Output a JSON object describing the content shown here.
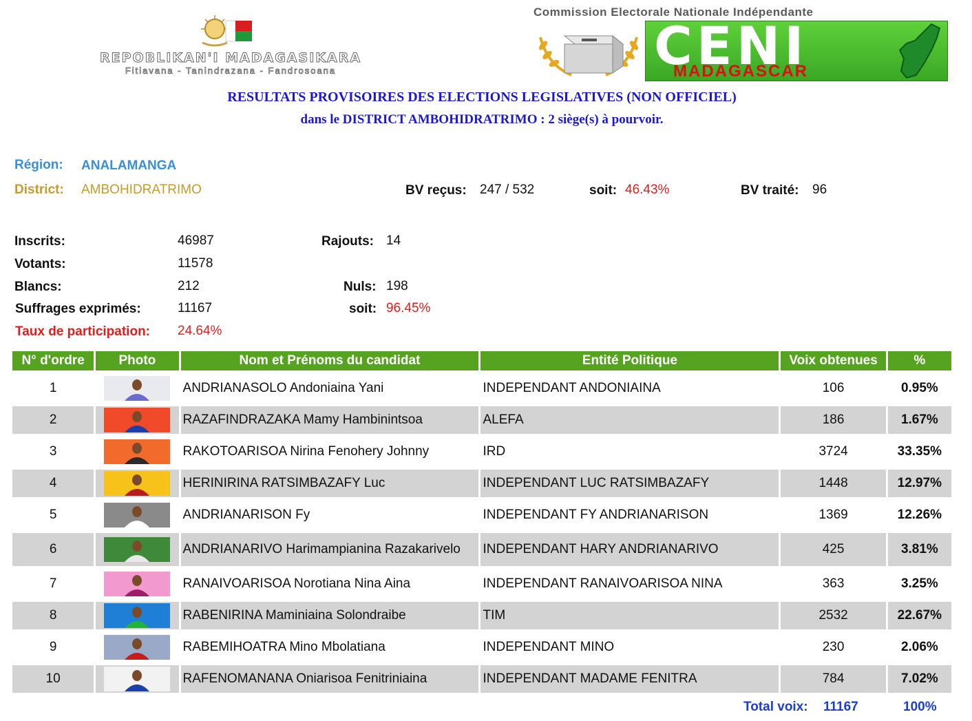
{
  "header": {
    "republic_name": "REPOBLIKAN'I MADAGASIKARA",
    "republic_motto": "Fitiavana - Tanindrazana - Fandrosoana",
    "commission_name": "Commission Electorale Nationale Indépendante",
    "ceni_acronym": "CENI",
    "ceni_country": "MADAGASCAR"
  },
  "title": {
    "line1": "RESULTATS PROVISOIRES DES ELECTIONS LEGISLATIVES (NON OFFICIEL)",
    "line2": "dans le DISTRICT  AMBOHIDRATRIMO : 2 siège(s) à pourvoir."
  },
  "info": {
    "region_label": "Région:",
    "region_value": "ANALAMANGA",
    "district_label": "District:",
    "district_value": "AMBOHIDRATRIMO",
    "bv_recus_label": "BV reçus:",
    "bv_recus_value": "247 / 532",
    "soit_label": "soit:",
    "soit_value": "46.43%",
    "bv_traite_label": "BV traité:",
    "bv_traite_value": "96"
  },
  "stats": {
    "inscrits_label": "Inscrits:",
    "inscrits_value": "46987",
    "rajouts_label": "Rajouts:",
    "rajouts_value": "14",
    "votants_label": "Votants:",
    "votants_value": "11578",
    "blancs_label": "Blancs:",
    "blancs_value": "212",
    "nuls_label": "Nuls:",
    "nuls_value": "198",
    "suffrages_label": "Suffrages exprimés:",
    "suffrages_value": "11167",
    "soit_label": "soit:",
    "soit_value": "96.45%",
    "taux_label": "Taux de participation:",
    "taux_value": "24.64%"
  },
  "table": {
    "headers": [
      "N° d'ordre",
      "Photo",
      "Nom et Prénoms du candidat",
      "Entité Politique",
      "Voix obtenues",
      "%"
    ],
    "rows": [
      {
        "num": "1",
        "name": "ANDRIANASOLO Andoniaina Yani",
        "entity": "INDEPENDANT ANDONIAINA",
        "votes": "106",
        "pct": "0.95%",
        "photo_bg": "#e9e9f0",
        "photo_accent": "#6a6ad0"
      },
      {
        "num": "2",
        "name": "RAZAFINDRAZAKA Mamy Hambinintsoa",
        "entity": "ALEFA",
        "votes": "186",
        "pct": "1.67%",
        "photo_bg": "#f04a2a",
        "photo_accent": "#1d3fa8"
      },
      {
        "num": "3",
        "name": "RAKOTOARISOA Nirina Fenohery Johnny",
        "entity": "IRD",
        "votes": "3724",
        "pct": "33.35%",
        "photo_bg": "#f26a2c",
        "photo_accent": "#2a2a2a"
      },
      {
        "num": "4",
        "name": "HERINIRINA RATSIMBAZAFY Luc",
        "entity": "INDEPENDANT LUC RATSIMBAZAFY",
        "votes": "1448",
        "pct": "12.97%",
        "photo_bg": "#f7c21a",
        "photo_accent": "#b81d1d"
      },
      {
        "num": "5",
        "name": "ANDRIANARISON Fy",
        "entity": "INDEPENDANT FY ANDRIANARISON",
        "votes": "1369",
        "pct": "12.26%",
        "photo_bg": "#8a8a8a",
        "photo_accent": "#ffffff"
      },
      {
        "num": "6",
        "name": "ANDRIANARIVO Harimampianina Razakarivelo",
        "entity": "INDEPENDANT HARY ANDRIANARIVO",
        "votes": "425",
        "pct": "3.81%",
        "photo_bg": "#3f8a3a",
        "photo_accent": "#e8e8e8"
      },
      {
        "num": "7",
        "name": "RANAIVOARISOA Norotiana Nina Aina",
        "entity": "INDEPENDANT RANAIVOARISOA NINA",
        "votes": "363",
        "pct": "3.25%",
        "photo_bg": "#f29ad0",
        "photo_accent": "#a01d6a"
      },
      {
        "num": "8",
        "name": "RABENIRINA Maminiaina Solondraibe",
        "entity": "TIM",
        "votes": "2532",
        "pct": "22.67%",
        "photo_bg": "#1f7fd6",
        "photo_accent": "#21b43a"
      },
      {
        "num": "9",
        "name": "RABEMIHOATRA Mino Mbolatiana",
        "entity": "INDEPENDANT MINO",
        "votes": "230",
        "pct": "2.06%",
        "photo_bg": "#9aa9c8",
        "photo_accent": "#c81d1d"
      },
      {
        "num": "10",
        "name": "RAFENOMANANA Oniarisoa Fenitriniaina",
        "entity": "INDEPENDANT MADAME FENITRA",
        "votes": "784",
        "pct": "7.02%",
        "photo_bg": "#f2f2f2",
        "photo_accent": "#1d3fa8"
      }
    ]
  },
  "totals": {
    "label": "Total voix:",
    "value": "11167",
    "pct": "100%"
  },
  "colors": {
    "header_green": "#55a31e",
    "title_blue": "#1a1acc",
    "region_blue": "#3a8fd8",
    "district_gold": "#c79a2c",
    "alert_red": "#e51c1c",
    "row_grey": "#d3d3d3"
  }
}
